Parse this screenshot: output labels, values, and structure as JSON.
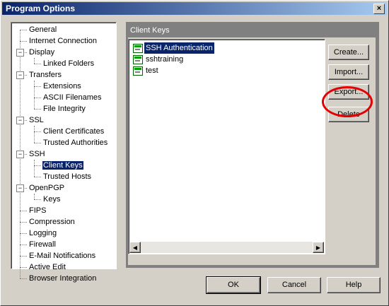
{
  "window": {
    "title": "Program Options",
    "close_glyph": "×"
  },
  "tree": {
    "items": [
      {
        "label": "General",
        "level": 0
      },
      {
        "label": "Internet Connection",
        "level": 0
      },
      {
        "label": "Display",
        "level": 0,
        "expander": "−"
      },
      {
        "label": "Linked Folders",
        "level": 1
      },
      {
        "label": "Transfers",
        "level": 0,
        "expander": "−"
      },
      {
        "label": "Extensions",
        "level": 1
      },
      {
        "label": "ASCII Filenames",
        "level": 1
      },
      {
        "label": "File Integrity",
        "level": 1
      },
      {
        "label": "SSL",
        "level": 0,
        "expander": "−"
      },
      {
        "label": "Client Certificates",
        "level": 1
      },
      {
        "label": "Trusted Authorities",
        "level": 1
      },
      {
        "label": "SSH",
        "level": 0,
        "expander": "−"
      },
      {
        "label": "Client Keys",
        "level": 1,
        "selected": true
      },
      {
        "label": "Trusted Hosts",
        "level": 1
      },
      {
        "label": "OpenPGP",
        "level": 0,
        "expander": "−"
      },
      {
        "label": "Keys",
        "level": 1
      },
      {
        "label": "FIPS",
        "level": 0
      },
      {
        "label": "Compression",
        "level": 0
      },
      {
        "label": "Logging",
        "level": 0
      },
      {
        "label": "Firewall",
        "level": 0
      },
      {
        "label": "E-Mail Notifications",
        "level": 0
      },
      {
        "label": "Active Edit",
        "level": 0
      },
      {
        "label": "Browser Integration",
        "level": 0
      }
    ]
  },
  "panel": {
    "title": "Client Keys",
    "keys": [
      "SSH Authentication",
      "sshtraining",
      "test"
    ],
    "selected_key_index": 0,
    "buttons": {
      "create": "Create...",
      "import": "Import...",
      "export": "Export...",
      "delete": "Delete"
    },
    "scroll_left": "◀",
    "scroll_right": "▶"
  },
  "footer": {
    "ok": "OK",
    "cancel": "Cancel",
    "help": "Help"
  },
  "colors": {
    "title_bar": "#0a246a",
    "selection": "#0a246a",
    "highlight_ring": "#e30000",
    "face": "#d4d0c8"
  }
}
